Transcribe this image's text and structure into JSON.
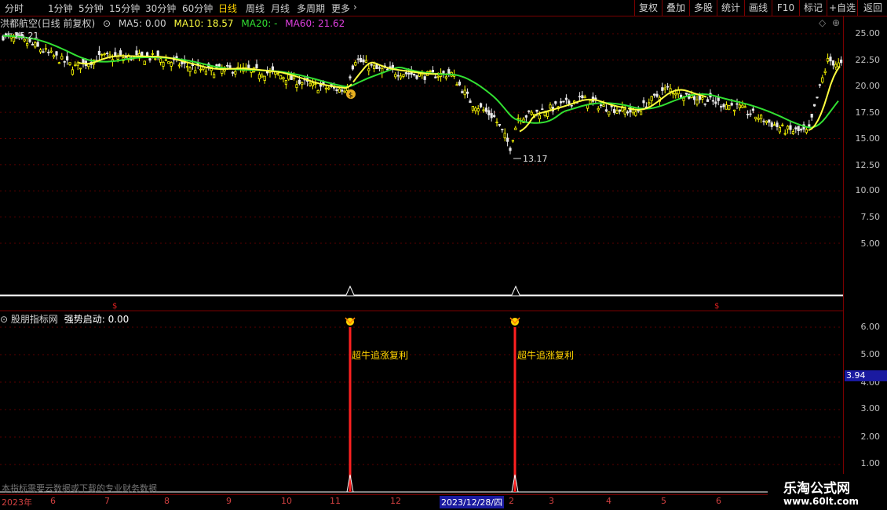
{
  "toolbar": {
    "periods": [
      "分时",
      "1分钟",
      "5分钟",
      "15分钟",
      "30分钟",
      "60分钟",
      "日线",
      "周线",
      "月线",
      "多周期",
      "更多"
    ],
    "active_period": "日线",
    "right_buttons": [
      "复权",
      "叠加",
      "多股",
      "统计",
      "画线",
      "F10",
      "标记",
      "+自选",
      "返回"
    ]
  },
  "legend": {
    "title": "洪都航空(日线 前复权)",
    "ma5": "MA5: 0.00",
    "ma10": "MA10: 18.57",
    "ma20": "MA20: -",
    "ma60": "MA60: 21.62"
  },
  "price_axis": {
    "ticks": [
      "25.00",
      "22.50",
      "20.00",
      "17.50",
      "15.00",
      "12.50",
      "10.00",
      "7.50",
      "5.00"
    ],
    "high_label": "25.21",
    "low_label": "13.17"
  },
  "indicator": {
    "title": "股朋指标网",
    "value_label": "强势启动: 0.00",
    "signal_text": "超牛追涨复利",
    "ticks": [
      "6.00",
      "5.00",
      "4.00",
      "3.00",
      "2.00",
      "1.00"
    ],
    "current_value": "3.94",
    "notice": "本指标需要云数据或下载的专业财务数据"
  },
  "date_axis": {
    "labels": [
      "2023年",
      "6",
      "7",
      "8",
      "9",
      "10",
      "11",
      "12",
      "2023/12/28/四",
      "2",
      "3",
      "4",
      "5",
      "6"
    ]
  },
  "watermark": {
    "title": "乐淘公式网",
    "url": "www.60lt.com"
  },
  "colors": {
    "ma10": "#ffff40",
    "ma20": "#32e032",
    "ma60": "#e040e0",
    "up": "#ffff00",
    "down": "#ffffff",
    "signal": "#ff2020",
    "accent": "#ffd400"
  }
}
